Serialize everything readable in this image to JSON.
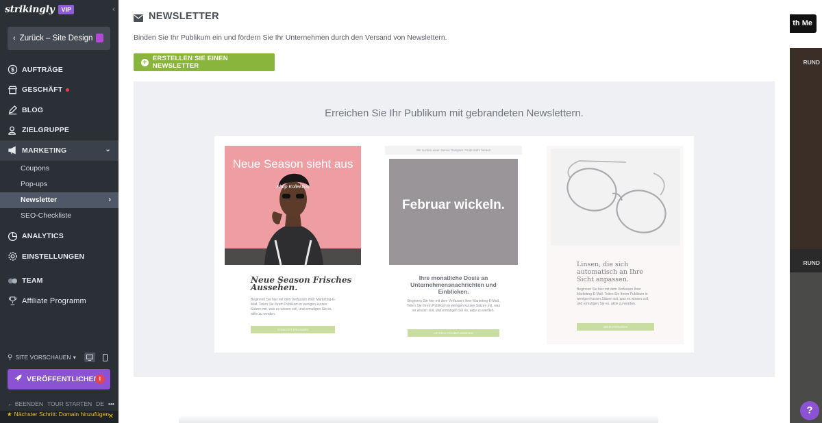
{
  "sidebar": {
    "logo": "strikingly",
    "vip": "VIP",
    "back_label": "Zurück – Site Design",
    "nav": [
      {
        "label": "AUFTRÄGE"
      },
      {
        "label": "GESCHÄFT"
      },
      {
        "label": "BLOG"
      },
      {
        "label": "ZIELGRUPPE"
      },
      {
        "label": "MARKETING"
      }
    ],
    "sub": [
      "Coupons",
      "Pop-ups",
      "Newsletter",
      "SEO-Checkliste"
    ],
    "nav2": [
      {
        "label": "ANALYTICS"
      },
      {
        "label": "EINSTELLUNGEN"
      },
      {
        "label": "TEAM"
      },
      {
        "label": "Affiliate Programm"
      }
    ],
    "preview_label": "SITE VORSCHAUEN",
    "publish_label": "VERÖFFENTLICHEN",
    "publish_alert": "!",
    "bottom": {
      "exit": "BEENDEN",
      "tour": "TOUR STARTEN",
      "lang": "DE",
      "more": "•••"
    },
    "next_step": "Nächster Schritt: Domain hinzufügen"
  },
  "main": {
    "title": "NEWSLETTER",
    "description": "Binden Sie Ihr Publikum ein und fördern Sie Ihr Unternehmen durch den Versand von Newslettern.",
    "create_label": "ERSTELLEN SIE EINEN NEWSLETTER",
    "showcase_title": "Erreichen Sie Ihr Publikum mit gebrandeten Newslettern.",
    "card1": {
      "photo_title": "Neue Season sieht aus",
      "photo_sub": "Shop Kollektion",
      "heading": "Neue Season Frisches Aussehen.",
      "body": "Beginnen Sie hier mit dem Verfassen Ihrer Marketing-E-Mail. Teilen Sie Ihrem Publikum in wenigen kurzen Sätzen mit, was es wissen soll, und ermutigen Sie es, aktiv zu werden.",
      "cta": "STANDORT ERKUNDEN"
    },
    "card2": {
      "topbar": "Wir suchen einen Senior Designer. Finde mehr heraus",
      "image_text": "Februar wickeln.",
      "heading": "Ihre monatliche Dosis an Unternehmensnachrichten und Einblicken.",
      "body": "Beginnen Sie hier mit dem Verfassen Ihrer Marketing-E-Mail. Teilen Sie Ihrem Publikum in wenigen kurzen Sätzen mit, was es wissen soll, und ermutigen Sie es, aktiv zu werden.",
      "cta": "LETZTES PROJEKT ANSEHEN"
    },
    "card3": {
      "heading": "Linsen, die sich automatisch an Ihre Sicht anpassen.",
      "body": "Beginnen Sie hier mit dem Verfassen Ihrer Marketing-E-Mail. Teilen Sie Ihrem Publikum in wenigen kurzen Sätzen mit, was es wissen soll, und ermutigen Sie es, aktiv zu werden.",
      "cta": "MEHR ERFAHREN"
    }
  },
  "right": {
    "button": "th Me",
    "label1": "RUND",
    "label2": "RUND",
    "help": "?"
  },
  "colors": {
    "sidebar_bg": "#2b2f36",
    "publish": "#8c52d4",
    "create_btn": "#8ab53c",
    "alert": "#e8414f"
  }
}
